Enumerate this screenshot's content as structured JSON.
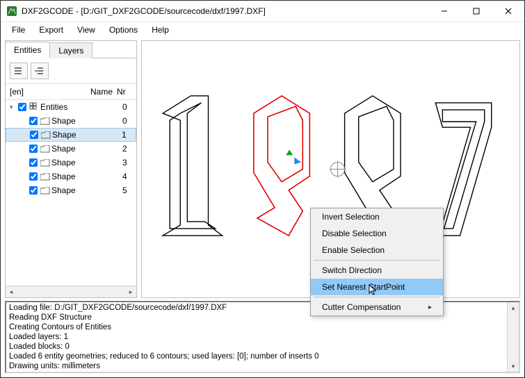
{
  "window": {
    "title": "DXF2GCODE - [D:/GIT_DXF2GCODE/sourcecode/dxf/1997.DXF]"
  },
  "menubar": {
    "items": [
      "File",
      "Export",
      "View",
      "Options",
      "Help"
    ]
  },
  "tabs": {
    "entities": "Entities",
    "layers": "Layers"
  },
  "tree": {
    "lang_label": "[en]",
    "col_name": "Name",
    "col_nr": "Nr",
    "rows": [
      {
        "name": "Entities",
        "nr": "0"
      },
      {
        "name": "Shape",
        "nr": "0"
      },
      {
        "name": "Shape",
        "nr": "1"
      },
      {
        "name": "Shape",
        "nr": "2"
      },
      {
        "name": "Shape",
        "nr": "3"
      },
      {
        "name": "Shape",
        "nr": "4"
      },
      {
        "name": "Shape",
        "nr": "5"
      }
    ]
  },
  "context_menu": {
    "items": [
      "Invert Selection",
      "Disable Selection",
      "Enable Selection",
      "__sep__",
      "Switch Direction",
      "Set Nearest StartPoint",
      "__sep__",
      "Cutter Compensation"
    ],
    "highlight_index": 5,
    "submenu_index": 7
  },
  "log": {
    "lines": [
      "Loading file: D:/GIT_DXF2GCODE/sourcecode/dxf/1997.DXF",
      "Reading DXF Structure",
      "Creating Contours of Entities",
      "Loaded layers: 1",
      "Loaded blocks: 0",
      "Loaded 6 entity geometries; reduced to 6 contours; used layers: [0]; number of inserts 0",
      "Drawing units: millimeters"
    ]
  }
}
